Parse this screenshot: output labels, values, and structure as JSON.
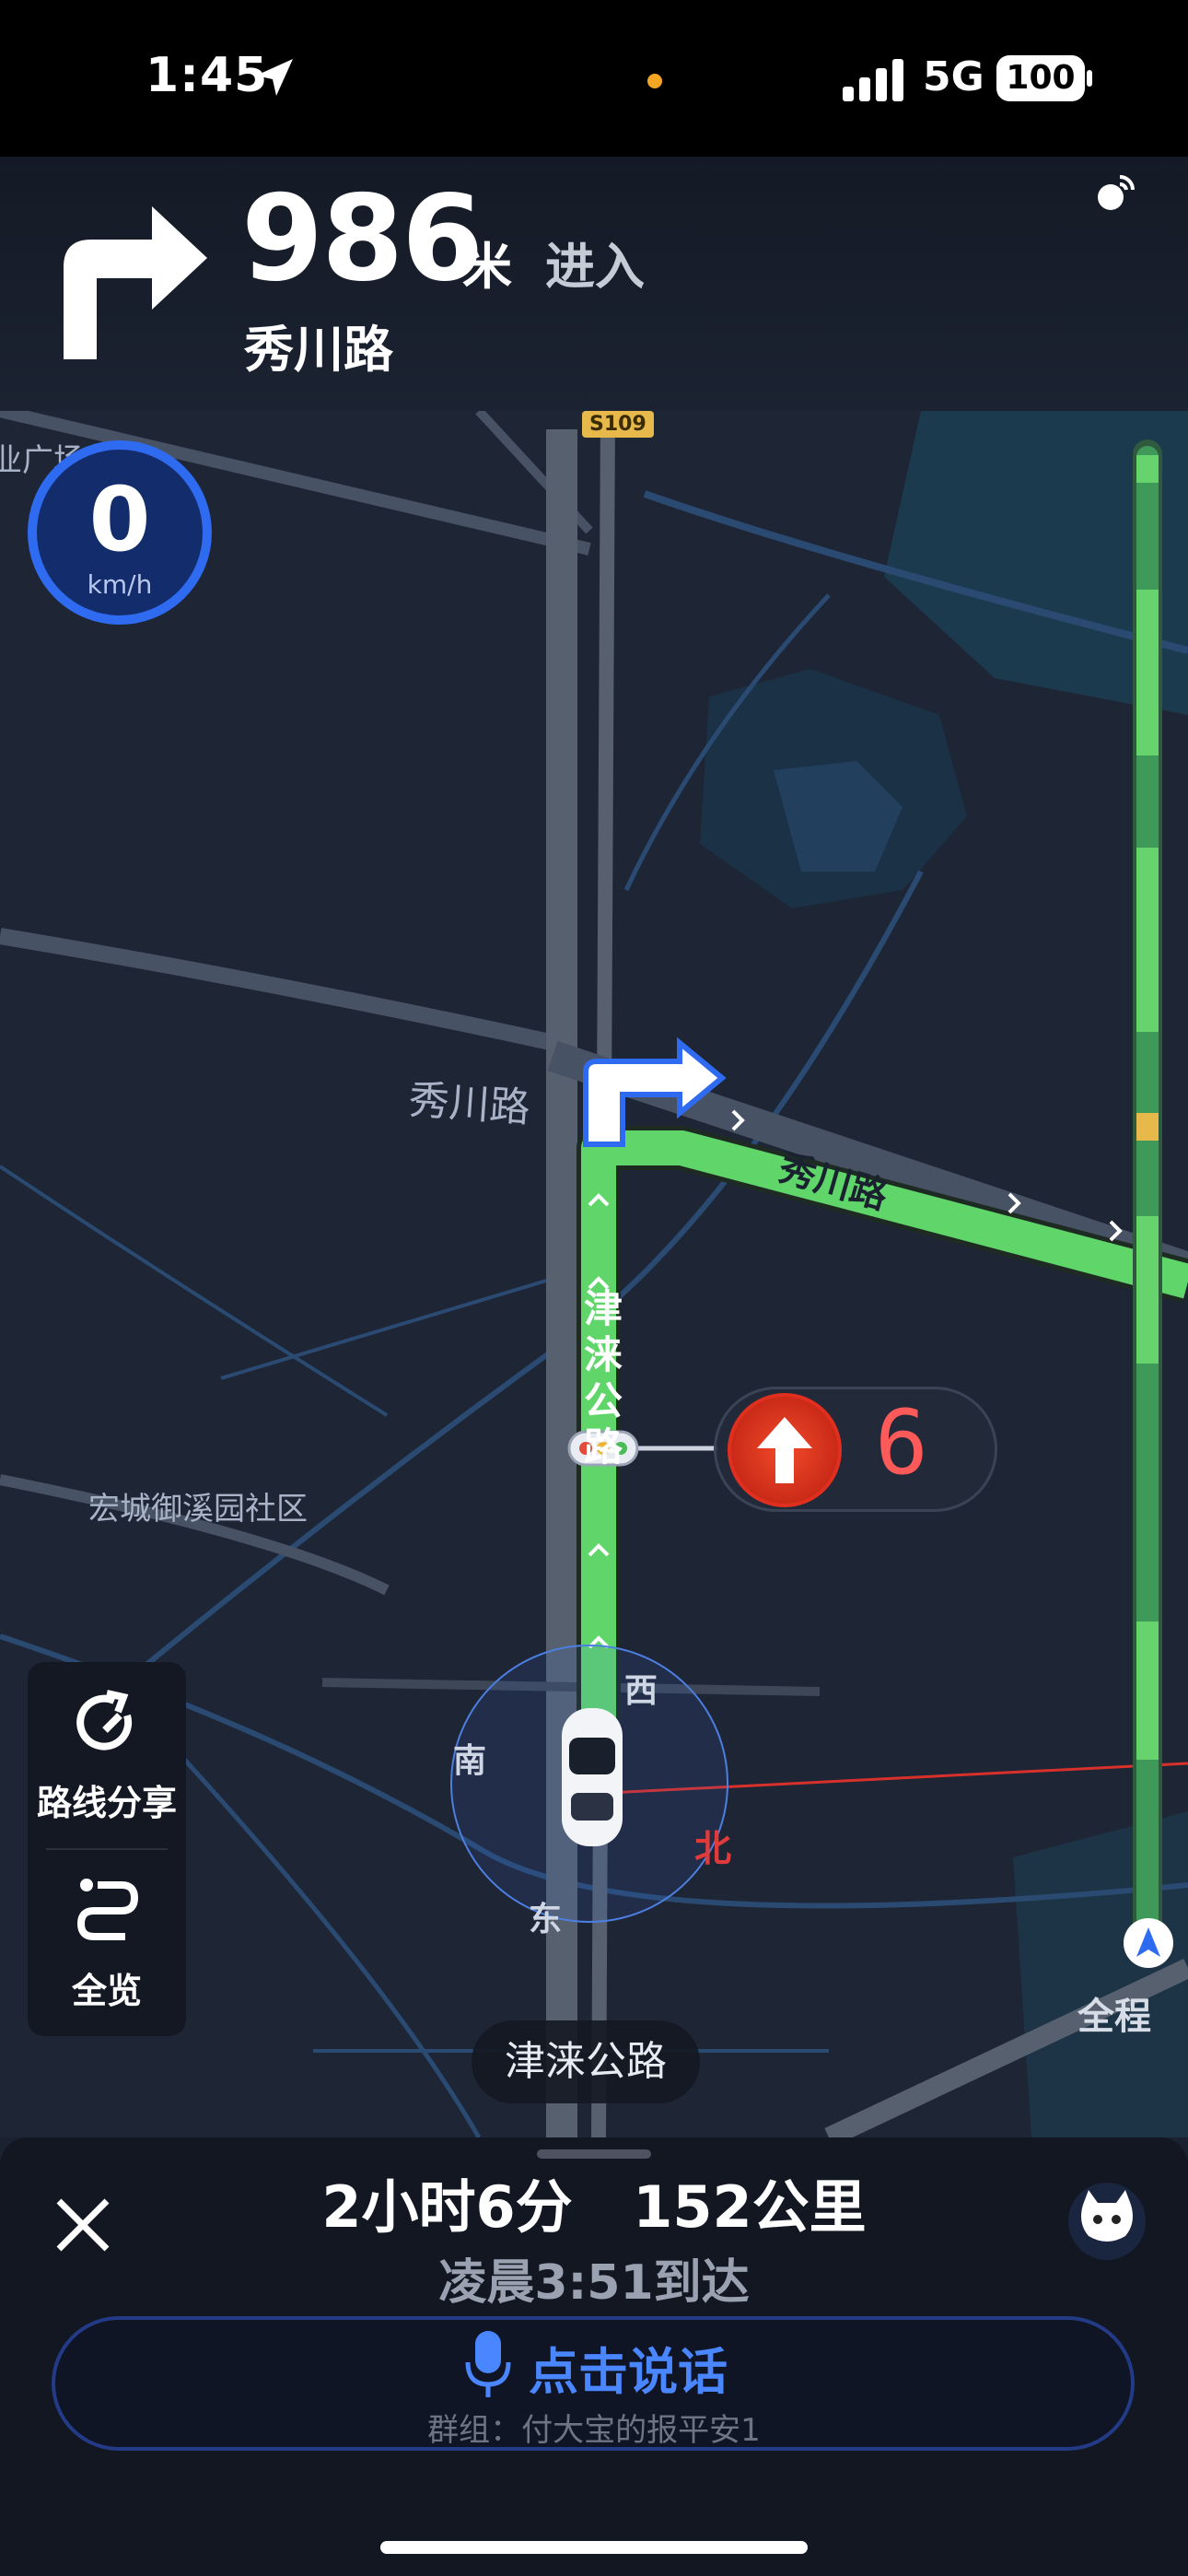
{
  "status_bar": {
    "time": "1:45",
    "network": "5G",
    "battery": "100",
    "dot_color": "#f5a623"
  },
  "navigation": {
    "distance": "986",
    "unit": "米",
    "action": "进入",
    "road": "秀川路",
    "turn_icon": "turn-right-icon"
  },
  "speed": {
    "value": "0",
    "unit": "km/h"
  },
  "map": {
    "highway_badge": "S109",
    "poi_partial": "业广场",
    "road_xiuchuan_left": "秀川路",
    "road_xiuchuan_route": "秀川路",
    "road_jinlai_vertical": "津\n涞\n公\n路",
    "community": "宏城御溪园社区",
    "compass": {
      "west": "西",
      "south": "南",
      "east": "东",
      "north": "北"
    }
  },
  "traffic_light": {
    "countdown": "6",
    "direction": "straight-arrow-icon",
    "color": "#e53b2a"
  },
  "side_panel": {
    "share_label": "路线分享",
    "overview_label": "全览"
  },
  "progress": {
    "label": "全程"
  },
  "current_road": "津涞公路",
  "trip": {
    "duration": "2小时6分",
    "distance": "152公里",
    "eta": "凌晨3:51到达"
  },
  "voice": {
    "label": "点击说话",
    "group": "群组：付大宝的报平安1"
  },
  "colors": {
    "route": "#5fd56a",
    "accent": "#2f6bf0",
    "voice": "#4a86ff"
  }
}
